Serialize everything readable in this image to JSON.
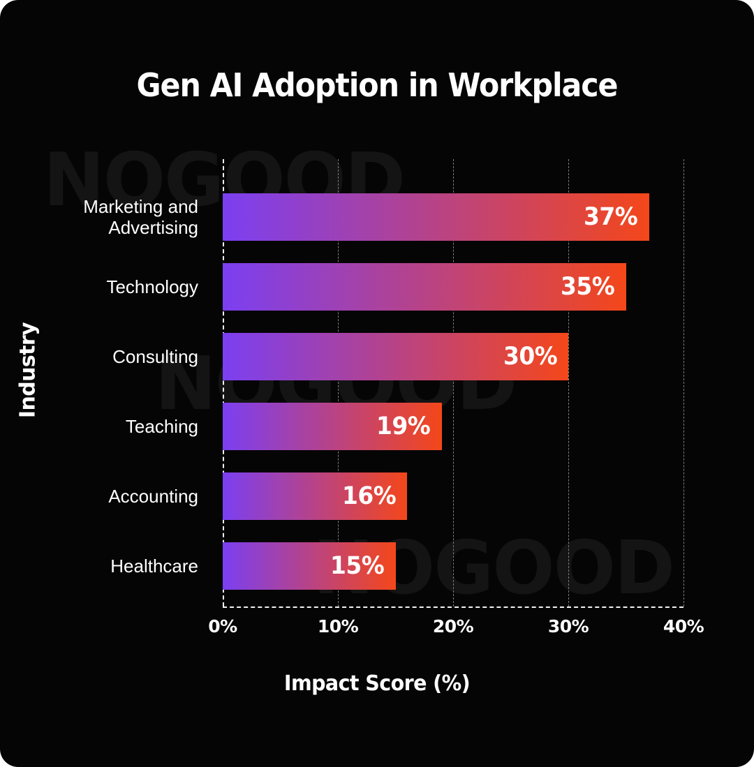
{
  "chart_data": {
    "type": "bar",
    "orientation": "horizontal",
    "title": "Gen AI Adoption in Workplace",
    "xlabel": "Impact Score (%)",
    "ylabel": "Industry",
    "xlim": [
      0,
      40
    ],
    "xticks": [
      "0%",
      "10%",
      "20%",
      "30%",
      "40%"
    ],
    "xtick_values": [
      0,
      10,
      20,
      30,
      40
    ],
    "grid": true,
    "legend": "none",
    "categories": [
      "Marketing and Advertising",
      "Technology",
      "Consulting",
      "Teaching",
      "Accounting",
      "Healthcare"
    ],
    "values": [
      37,
      35,
      30,
      19,
      16,
      15
    ],
    "value_labels": [
      "37%",
      "35%",
      "30%",
      "19%",
      "16%",
      "15%"
    ],
    "bars": [
      {
        "category_line1": "Marketing and",
        "category_line2": "Advertising",
        "value": 37,
        "label": "37%"
      },
      {
        "category_line1": "Technology",
        "category_line2": "",
        "value": 35,
        "label": "35%"
      },
      {
        "category_line1": "Consulting",
        "category_line2": "",
        "value": 30,
        "label": "30%"
      },
      {
        "category_line1": "Teaching",
        "category_line2": "",
        "value": 19,
        "label": "19%"
      },
      {
        "category_line1": "Accounting",
        "category_line2": "",
        "value": 16,
        "label": "16%"
      },
      {
        "category_line1": "Healthcare",
        "category_line2": "",
        "value": 15,
        "label": "15%"
      }
    ]
  },
  "colors": {
    "background": "#050505",
    "gradient_start": "#7b3ff2",
    "gradient_end": "#f4471a",
    "text": "#ffffff",
    "gridline": "#7d7d7d",
    "axis": "#f2f2f2",
    "watermark": "#141414"
  },
  "watermark": {
    "text": "NOGOOD",
    "instances": [
      "NOGOOD",
      "NOGOOD",
      "NOGOOD"
    ]
  }
}
